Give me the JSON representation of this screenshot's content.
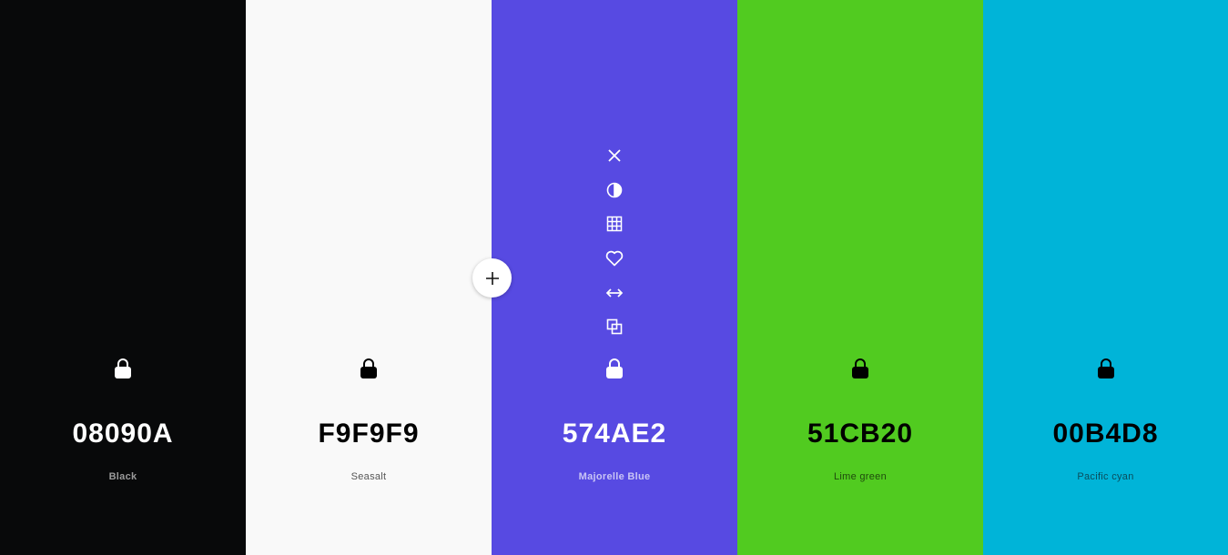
{
  "swatches": [
    {
      "hex": "08090A",
      "name": "Black",
      "bg": "#08090A",
      "fg": "#ffffff",
      "name_color": "#9a9a9a",
      "name_bold": true,
      "locked": false,
      "show_tools": false
    },
    {
      "hex": "F9F9F9",
      "name": "Seasalt",
      "bg": "#F9F9F9",
      "fg": "#000000",
      "name_color": "#555555",
      "name_bold": false,
      "locked": true,
      "show_tools": false
    },
    {
      "hex": "574AE2",
      "name": "Majorelle Blue",
      "bg": "#574AE2",
      "fg": "#ffffff",
      "name_color": "#c9c4f5",
      "name_bold": true,
      "locked": false,
      "show_tools": true
    },
    {
      "hex": "51CB20",
      "name": "Lime green",
      "bg": "#51CB20",
      "fg": "#000000",
      "name_color": "#1f4a0d",
      "name_bold": false,
      "locked": true,
      "show_tools": false
    },
    {
      "hex": "00B4D8",
      "name": "Pacific cyan",
      "bg": "#00B4D8",
      "fg": "#000000",
      "name_color": "#0a4d5c",
      "name_bold": false,
      "locked": true,
      "show_tools": false
    }
  ],
  "tools": [
    "close-icon",
    "contrast-icon",
    "shades-grid-icon",
    "heart-icon",
    "drag-arrows-icon",
    "copy-icon"
  ]
}
